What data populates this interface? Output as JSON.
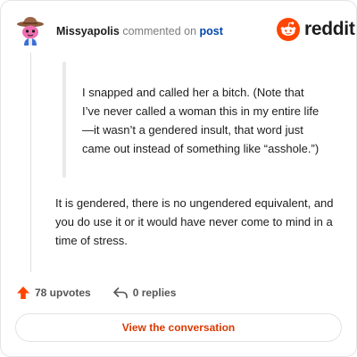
{
  "header": {
    "username": "Missyapolis",
    "commented_on": "commented on",
    "post_link": "post",
    "avatar_icon": "snoo-avatar-cowboy-hat-icon"
  },
  "brand": {
    "wordmark": "reddit",
    "logo_icon": "reddit-snoo-icon",
    "accent_color": "#ff4500"
  },
  "quote": {
    "text": "I snapped and called her a bitch. (Note that I’ve never called a woman this in my entire life—it wasn’t a gendered insult, that word just came out instead of something like “asshole.”)"
  },
  "reply": {
    "text": "It is gendered, there is no ungendered equivalent, and you do use it or it would have never come to mind in a time of stress."
  },
  "actions": {
    "upvotes_label": "78 upvotes",
    "replies_label": "0 replies",
    "upvote_icon": "upvote-arrow-icon",
    "reply_icon": "reply-arrow-icon"
  },
  "cta": {
    "label": "View the conversation"
  }
}
